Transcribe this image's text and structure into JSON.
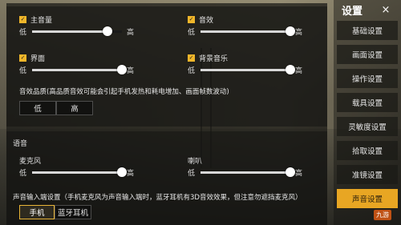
{
  "audio": {
    "master": {
      "label": "主音量",
      "checked": true,
      "low": "低",
      "high": "高",
      "level": 0.84
    },
    "sfx": {
      "label": "音效",
      "checked": true,
      "low": "低",
      "high": "高",
      "level": 1.0
    },
    "ui": {
      "label": "界面",
      "checked": true,
      "low": "低",
      "high": "高",
      "level": 1.0
    },
    "bgm": {
      "label": "背景音乐",
      "checked": true,
      "low": "低",
      "high": "高",
      "level": 1.0
    },
    "quality": {
      "label": "音效品质(高品质音效可能会引起手机发热和耗电增加、画面帧数波动)",
      "options": [
        "低",
        "高"
      ],
      "selected": "高"
    }
  },
  "voice": {
    "title": "语音",
    "mic": {
      "label": "麦克风",
      "low": "低",
      "high": "高",
      "level": 1.0
    },
    "speaker": {
      "label": "喇叭",
      "low": "低",
      "high": "高",
      "level": 1.0
    },
    "input": {
      "label": "声音输入端设置（手机麦克风为声音输入端时，蓝牙耳机有3D音效效果，但注意勿遮挡麦克风）",
      "options": [
        "手机",
        "蓝牙耳机"
      ],
      "selected": "手机"
    }
  },
  "nav": {
    "title": "设置",
    "close_icon": "×",
    "items": [
      "基础设置",
      "画面设置",
      "操作设置",
      "载具设置",
      "灵敏度设置",
      "拾取设置",
      "准镜设置",
      "声音设置"
    ],
    "active": "声音设置"
  },
  "watermark": "九游",
  "colors": {
    "accent": "#e8a623",
    "checkbox": "#f0b62a"
  }
}
